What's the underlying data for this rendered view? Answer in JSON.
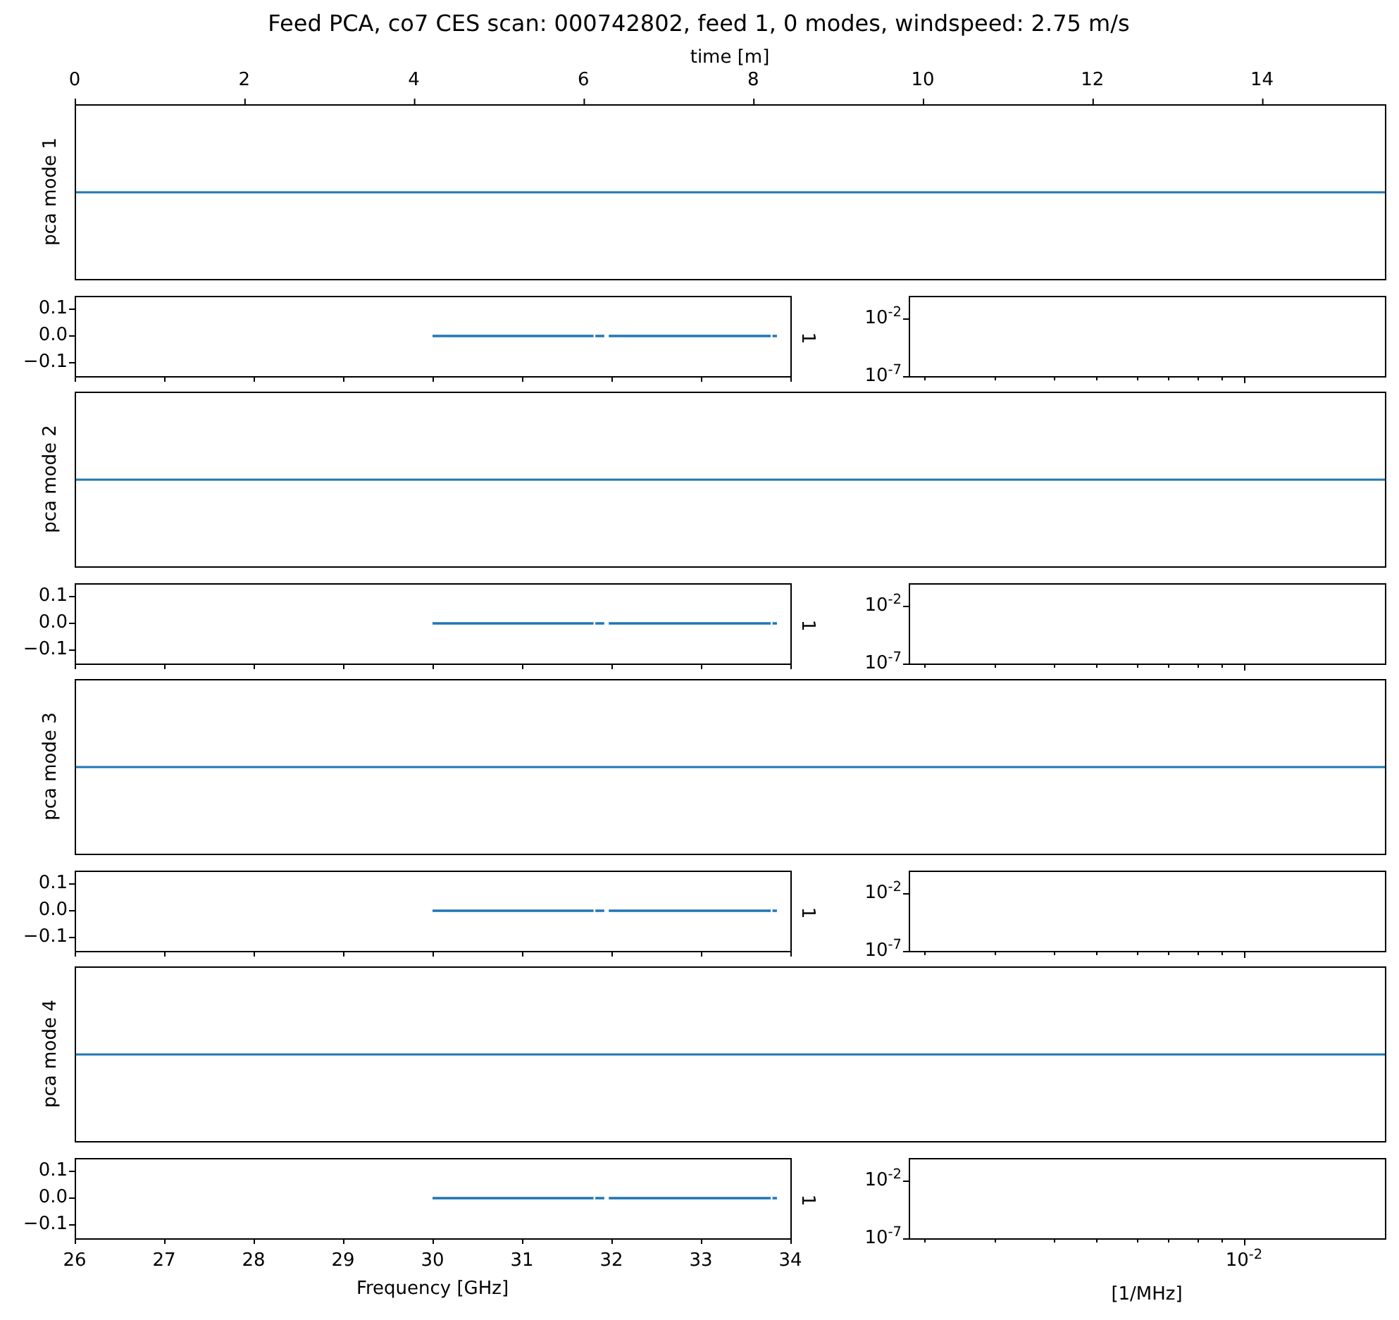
{
  "title": "Feed PCA, co7 CES scan: 000742802, feed 1, 0 modes, windspeed: 2.75 m/s",
  "time_axis": {
    "label": "time [m]",
    "ticks": [
      "0",
      "2",
      "4",
      "6",
      "8",
      "10",
      "12",
      "14"
    ]
  },
  "modes": [
    {
      "ylabel": "pca mode 1",
      "yticks": [
        "0.1",
        "0.0",
        "−0.1"
      ],
      "side_label": "1",
      "log_yticks": [
        "10$^{-2}$",
        "10$^{-7}$"
      ]
    },
    {
      "ylabel": "pca mode 2",
      "yticks": [
        "0.1",
        "0.0",
        "−0.1"
      ],
      "side_label": "1",
      "log_yticks": [
        "10$^{-2}$",
        "10$^{-7}$"
      ]
    },
    {
      "ylabel": "pca mode 3",
      "yticks": [
        "0.1",
        "0.0",
        "−0.1"
      ],
      "side_label": "1",
      "log_yticks": [
        "10$^{-2}$",
        "10$^{-7}$"
      ]
    },
    {
      "ylabel": "pca mode 4",
      "yticks": [
        "0.1",
        "0.0",
        "−0.1"
      ],
      "side_label": "1",
      "log_yticks": [
        "10$^{-2}$",
        "10$^{-7}$"
      ]
    }
  ],
  "frequency_axis": {
    "label": "Frequency [GHz]",
    "ticks": [
      "26",
      "27",
      "28",
      "29",
      "30",
      "31",
      "32",
      "33",
      "34"
    ]
  },
  "log_axis": {
    "label": "[1/MHz]",
    "ticks": [
      "10$^{-2}$"
    ]
  }
}
